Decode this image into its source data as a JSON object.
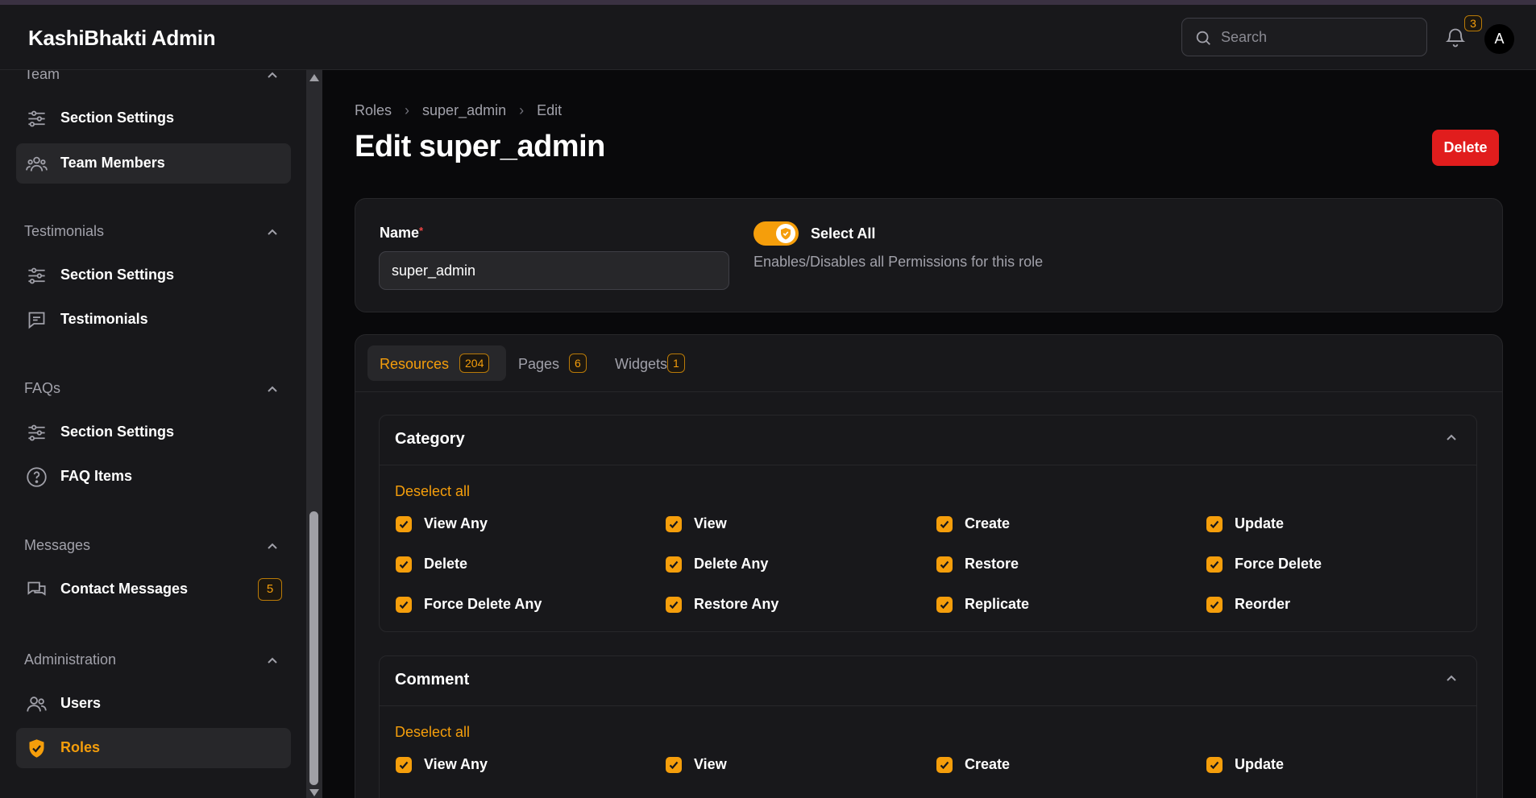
{
  "app": {
    "title": "KashiBhakti Admin"
  },
  "header": {
    "search_placeholder": "Search",
    "notifications_count": "3",
    "avatar_initial": "A"
  },
  "sidebar": {
    "groups": [
      {
        "label": "Team",
        "items": [
          {
            "label": "Section Settings",
            "icon": "sliders-icon"
          },
          {
            "label": "Team Members",
            "icon": "users-group-icon"
          }
        ]
      },
      {
        "label": "Testimonials",
        "items": [
          {
            "label": "Section Settings",
            "icon": "sliders-icon"
          },
          {
            "label": "Testimonials",
            "icon": "chat-bubble-icon"
          }
        ]
      },
      {
        "label": "FAQs",
        "items": [
          {
            "label": "Section Settings",
            "icon": "sliders-icon"
          },
          {
            "label": "FAQ Items",
            "icon": "question-circle-icon"
          }
        ]
      },
      {
        "label": "Messages",
        "items": [
          {
            "label": "Contact Messages",
            "icon": "chat-bubbles-icon",
            "badge": "5"
          }
        ]
      },
      {
        "label": "Administration",
        "items": [
          {
            "label": "Users",
            "icon": "users-icon"
          },
          {
            "label": "Roles",
            "icon": "shield-check-icon"
          }
        ]
      }
    ]
  },
  "breadcrumbs": [
    "Roles",
    "super_admin",
    "Edit"
  ],
  "page": {
    "title": "Edit super_admin",
    "delete_label": "Delete"
  },
  "form": {
    "name_label": "Name",
    "required_mark": "*",
    "name_value": "super_admin",
    "select_all_label": "Select All",
    "select_all_on": true,
    "select_all_hint": "Enables/Disables all Permissions for this role"
  },
  "tabs": [
    {
      "label": "Resources",
      "count": "204",
      "active": true
    },
    {
      "label": "Pages",
      "count": "6",
      "active": false
    },
    {
      "label": "Widgets",
      "count": "1",
      "active": false
    }
  ],
  "sections": [
    {
      "title": "Category",
      "deselect_label": "Deselect all",
      "permissions": [
        "View Any",
        "View",
        "Create",
        "Update",
        "Delete",
        "Delete Any",
        "Restore",
        "Force Delete",
        "Force Delete Any",
        "Restore Any",
        "Replicate",
        "Reorder"
      ]
    },
    {
      "title": "Comment",
      "deselect_label": "Deselect all",
      "permissions": [
        "View Any",
        "View",
        "Create",
        "Update"
      ]
    }
  ],
  "colors": {
    "accent": "#f59e0b",
    "danger": "#e11d1d",
    "surface": "#18181b",
    "background": "#09090b"
  }
}
